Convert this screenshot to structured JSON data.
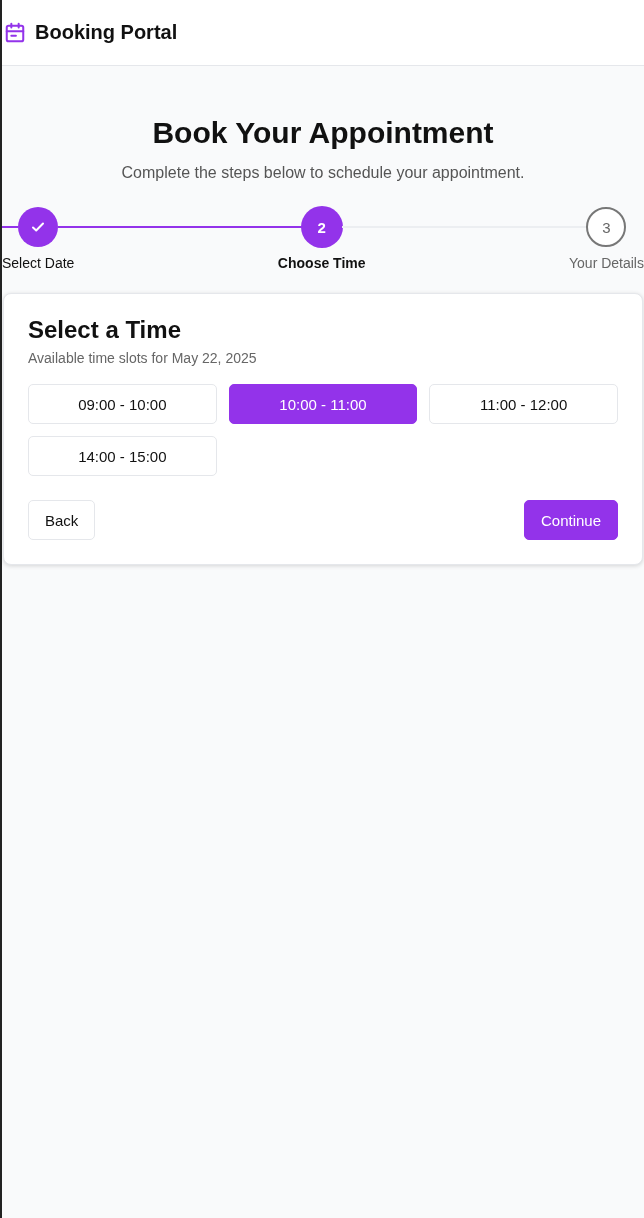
{
  "header": {
    "title": "Booking Portal"
  },
  "heading": "Book Your Appointment",
  "subtitle": "Complete the steps below to schedule your appointment.",
  "steps": [
    {
      "label": "Select Date",
      "completed": true,
      "selected": false
    },
    {
      "number": "2",
      "label": "Choose Time",
      "completed": false,
      "selected": true
    },
    {
      "number": "3",
      "label": "Your Details",
      "completed": false,
      "selected": false
    }
  ],
  "card": {
    "title": "Select a Time",
    "subtitle": "Available time slots for May 22, 2025",
    "slots": [
      {
        "label": "09:00 - 10:00",
        "selected": false
      },
      {
        "label": "10:00 - 11:00",
        "selected": true
      },
      {
        "label": "11:00 - 12:00",
        "selected": false
      },
      {
        "label": "14:00 - 15:00",
        "selected": false
      }
    ],
    "back": "Back",
    "continue": "Continue"
  }
}
